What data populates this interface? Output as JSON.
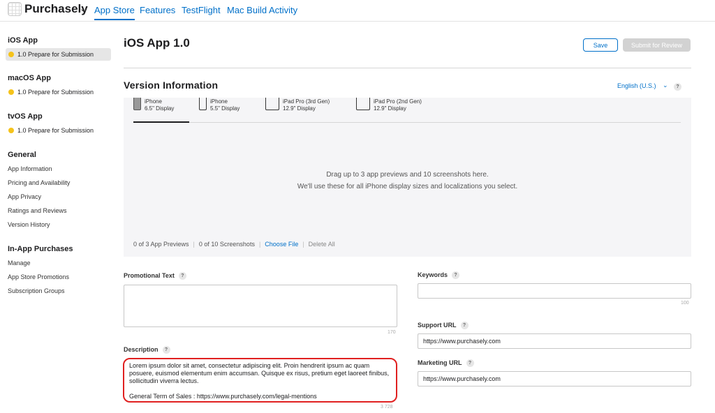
{
  "topbar": {
    "brand": "Purchasely",
    "tabs": [
      "App Store",
      "Features",
      "TestFlight",
      "Mac Build Activity"
    ]
  },
  "sidebar": {
    "ios_app": {
      "title": "iOS App",
      "status": "1.0 Prepare for Submission"
    },
    "macos_app": {
      "title": "macOS App",
      "status": "1.0 Prepare for Submission"
    },
    "tvos_app": {
      "title": "tvOS App",
      "status": "1.0 Prepare for Submission"
    },
    "general": {
      "title": "General",
      "items": [
        "App Information",
        "Pricing and Availability",
        "App Privacy",
        "Ratings and Reviews",
        "Version History"
      ]
    },
    "iap": {
      "title": "In-App Purchases",
      "items": [
        "Manage",
        "App Store Promotions",
        "Subscription Groups"
      ]
    }
  },
  "header": {
    "title": "iOS App 1.0",
    "save_label": "Save",
    "submit_label": "Submit for Review"
  },
  "version_info": {
    "title": "Version Information",
    "language": "English (U.S.)",
    "help": "?"
  },
  "media": {
    "device_tabs": [
      {
        "line1": "iPhone",
        "line2": "6.5\" Display"
      },
      {
        "line1": "iPhone",
        "line2": "5.5\" Display"
      },
      {
        "line1": "iPad Pro (3rd Gen)",
        "line2": "12.9\" Display"
      },
      {
        "line1": "iPad Pro (2nd Gen)",
        "line2": "12.9\" Display"
      }
    ],
    "drop_line1": "Drag up to 3 app previews and 10 screenshots here.",
    "drop_line2": "We'll use these for all iPhone display sizes and localizations you select.",
    "previews_count": "0 of 3 App Previews",
    "screenshots_count": "0 of 10 Screenshots",
    "choose_file": "Choose File",
    "delete_all": "Delete All"
  },
  "form": {
    "promotional_text": {
      "label": "Promotional Text",
      "value": "",
      "counter": "170"
    },
    "description": {
      "label": "Description",
      "paragraph1": "Lorem ipsum dolor sit amet, consectetur adipiscing elit. Proin hendrerit ipsum ac quam posuere, euismod elementum enim accumsan. Quisque ex risus, pretium eget laoreet finibus, sollicitudin viverra lectus.",
      "paragraph2": "General Term of Sales : https://www.purchasely.com/legal-mentions",
      "counter": "3 728"
    },
    "keywords": {
      "label": "Keywords",
      "value": "",
      "counter": "100"
    },
    "support_url": {
      "label": "Support URL",
      "value": "https://www.purchasely.com"
    },
    "marketing_url": {
      "label": "Marketing URL",
      "value": "https://www.purchasely.com"
    },
    "help": "?"
  },
  "colors": {
    "accent": "#0070c9",
    "status_dot": "#f5c31b",
    "highlight_border": "#e02020"
  }
}
